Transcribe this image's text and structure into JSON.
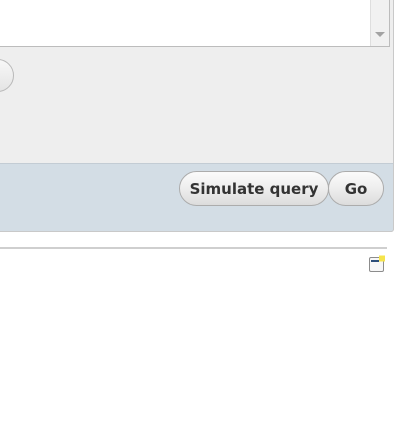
{
  "footer": {
    "simulate_label": "Simulate query",
    "go_label": "Go"
  },
  "icons": {
    "scroll_down": "scroll-down-arrow-icon",
    "panel_window": "window-icon"
  },
  "colors": {
    "panel_background": "#eeeeee",
    "footer_background": "#d3dde5",
    "button_text": "#333333",
    "icon_accent": "#f5e44c",
    "icon_titlebar": "#2d4f7a"
  }
}
